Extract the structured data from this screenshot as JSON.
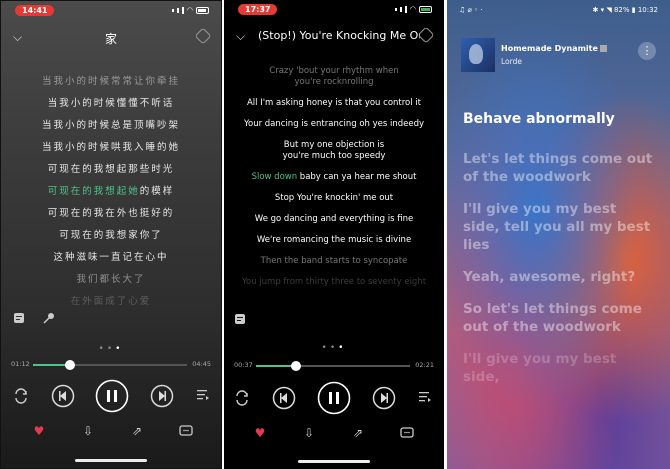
{
  "phone1": {
    "status_time": "14:41",
    "header_title": "家",
    "lyrics": [
      {
        "text": "当我小的时候常常让你牵挂",
        "state": "dim"
      },
      {
        "text": "当我小的时候懂懂不听话",
        "state": "normal"
      },
      {
        "text": "当我小的时候总是顶嘴吵架",
        "state": "normal"
      },
      {
        "text": "当我小的时候哄我入睡的她",
        "state": "normal"
      },
      {
        "text": "可现在的我想起那些时光",
        "state": "normal"
      },
      {
        "text": "可现在的我想起她",
        "highlight_suffix": "的模样",
        "state": "current"
      },
      {
        "text": "可现在的我在外也挺好的",
        "state": "normal"
      },
      {
        "text": "可现在的我想家你了",
        "state": "normal"
      },
      {
        "text": "这种滋味一直记在心中",
        "state": "normal"
      },
      {
        "text": "我们都长大了",
        "state": "normal"
      },
      {
        "text": "在外面成了心爱",
        "state": "faint"
      }
    ],
    "time_elapsed": "01:12",
    "time_total": "04:45",
    "progress": 0.24
  },
  "phone2": {
    "status_time": "17:37",
    "header_title": "(Stop!) You're Knocking Me Out",
    "lyrics": [
      {
        "text": "Crazy 'bout your rhythm when\nyou're rocknrolling",
        "state": "dim"
      },
      {
        "text": "All I'm asking honey is that you control it",
        "state": "normal"
      },
      {
        "text": "Your dancing is entrancing oh yes indeedy",
        "state": "normal"
      },
      {
        "text": "But my one objection is\nyou're much too speedy",
        "state": "normal"
      },
      {
        "text": "Slow down",
        "highlight_suffix": " baby can ya hear me shout",
        "state": "current"
      },
      {
        "text": "Stop You're knockin' me out",
        "state": "normal"
      },
      {
        "text": "We go dancing and everything is fine",
        "state": "normal"
      },
      {
        "text": "We're romancing the music is divine",
        "state": "normal"
      },
      {
        "text": "Then the band starts to syncopate",
        "state": "dim"
      },
      {
        "text": "You jump from thirty three to seventy eight",
        "state": "faint"
      }
    ],
    "time_elapsed": "00:37",
    "time_total": "02:21",
    "progress": 0.26
  },
  "phone3": {
    "status_left": "♫ ⌀ ◦ ·",
    "status_right": "✱ ▾ ◥ 82% ▮ 10:32",
    "song_title": "Homemade Dynamite",
    "artist": "Lorde",
    "lyrics": [
      {
        "text": "Behave abnormally",
        "state": "current"
      },
      {
        "text": "Let's let things come out of the woodwork",
        "state": "dim"
      },
      {
        "text": "I'll give you my best side, tell you all my best lies",
        "state": "dim"
      },
      {
        "text": "Yeah, awesome, right?",
        "state": "dim"
      },
      {
        "text": "So let's let things come out of the woodwork",
        "state": "dim"
      },
      {
        "text": "I'll give you my best side,",
        "state": "faint"
      }
    ]
  },
  "colors": {
    "highlight": "#4ec38a",
    "like": "#e53950",
    "status_pill": "#e53935"
  },
  "icons": [
    "chevron-down-icon",
    "settings-icon",
    "lyrics-icon",
    "mic-icon",
    "repeat-icon",
    "prev-icon",
    "pause-icon",
    "next-icon",
    "playlist-icon",
    "heart-icon",
    "download-icon",
    "share-icon",
    "comment-icon",
    "more-icon"
  ]
}
